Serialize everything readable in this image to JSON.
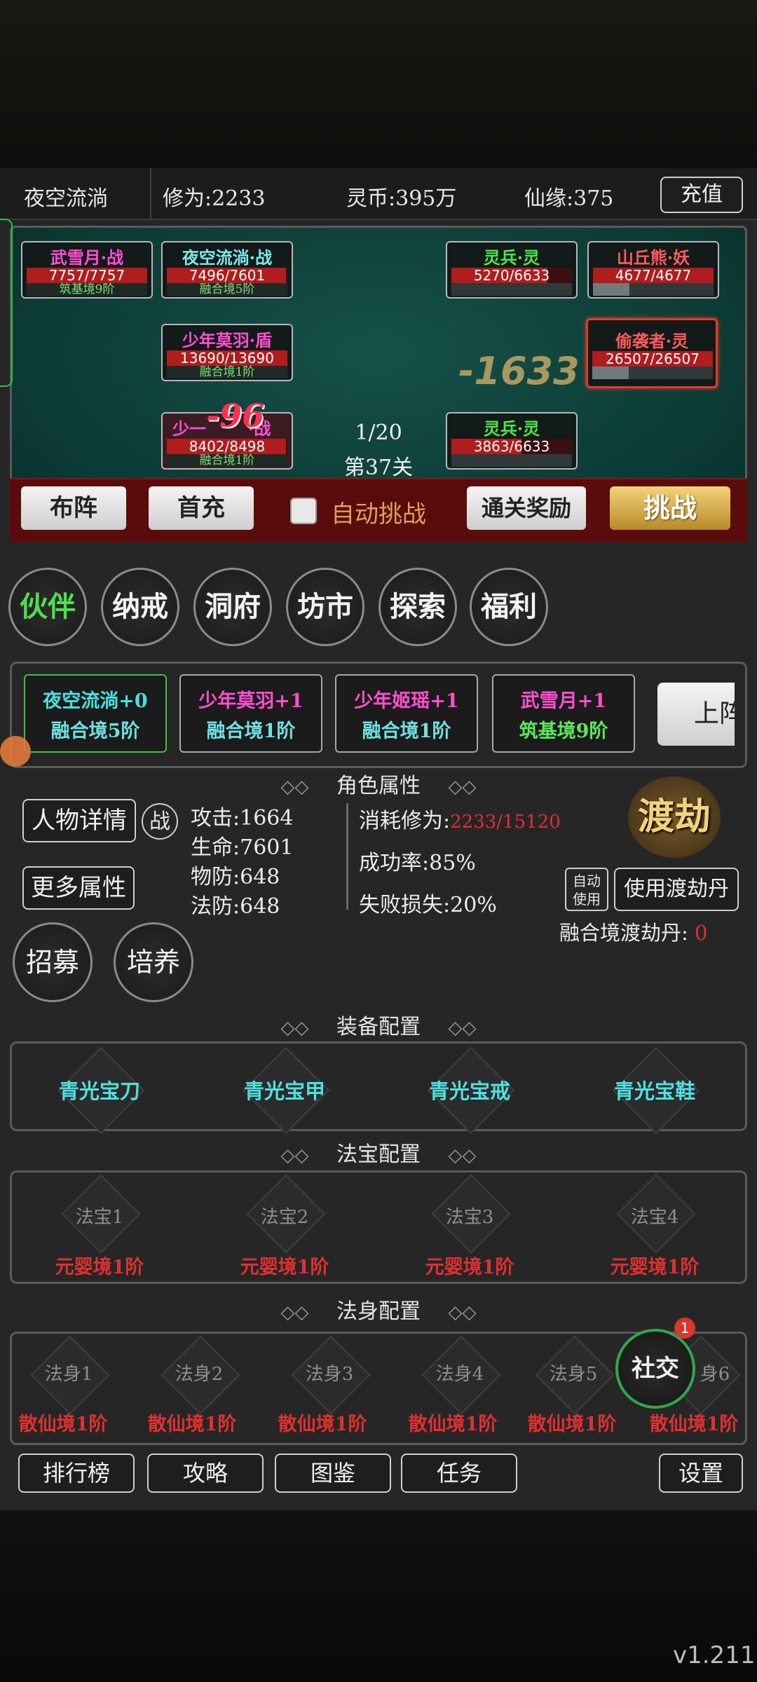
{
  "topbar": {
    "player": "夜空流淌",
    "cultivation": "修为:2233",
    "coins": "灵币:395万",
    "fate": "仙缘:375",
    "recharge": "充值"
  },
  "battle": {
    "allies": [
      {
        "name": "武雪月·战",
        "hp": "7757/7757",
        "realm": "筑基境9阶",
        "hp_frac": 1.0,
        "color": "#ff4fd0"
      },
      {
        "name": "夜空流淌·战",
        "hp": "7496/7601",
        "realm": "融合境5阶",
        "hp_frac": 0.986,
        "color": "#7de8e8"
      },
      {
        "name": "少年莫羽·盾",
        "hp": "13690/13690",
        "realm": "融合境1阶",
        "hp_frac": 1.0,
        "color": "#ff4fd0"
      },
      {
        "name": "少一",
        "hp": "8402/8498",
        "realm": "融合境1阶",
        "hp_frac": 0.989,
        "color": "#ff4fd0",
        "suffix": "·战",
        "damage": "-96"
      }
    ],
    "enemies": [
      {
        "name": "灵兵·灵",
        "hp": "5270/6633",
        "hp_frac": 0.795,
        "color": "#4be84b",
        "mp_frac": 0.0
      },
      {
        "name": "山丘熊·妖",
        "hp": "4677/4677",
        "hp_frac": 1.0,
        "color": "#ff5a5a",
        "mp_frac": 0.3
      },
      {
        "name": "偷袭者·灵",
        "hp": "26507/26507",
        "hp_frac": 1.0,
        "color": "#ff5a5a",
        "mp_frac": 0.3
      },
      {
        "name": "灵兵·灵",
        "hp": "3863/6633",
        "hp_frac": 0.58,
        "color": "#4be84b",
        "mp_frac": 0.0
      }
    ],
    "floating_damage": "-1633",
    "wave": "1/20",
    "stage": "第37关",
    "controls": {
      "formation": "布阵",
      "first_charge": "首充",
      "auto_label": "自动挑战",
      "clear_reward": "通关奖励",
      "challenge": "挑战"
    }
  },
  "nav": [
    "伙伴",
    "纳戒",
    "洞府",
    "坊市",
    "探索",
    "福利"
  ],
  "team": [
    {
      "name": "夜空流淌+0",
      "realm": "融合境5阶",
      "name_color": "#4be0e0",
      "realm_color": "#6fe0e0"
    },
    {
      "name": "少年莫羽+1",
      "realm": "融合境1阶",
      "name_color": "#ff4fd0",
      "realm_color": "#6fe0e0"
    },
    {
      "name": "少年姬瑶+1",
      "realm": "融合境1阶",
      "name_color": "#ff4fd0",
      "realm_color": "#6fe0e0"
    },
    {
      "name": "武雪月+1",
      "realm": "筑基境9阶",
      "name_color": "#ff4fd0",
      "realm_color": "#5be85b"
    }
  ],
  "team_more": "上阵",
  "attributes": {
    "header": "角色属性",
    "detail_btn": "人物详情",
    "battle_tag": "战",
    "more_btn": "更多属性",
    "attack": "攻击:1664",
    "life": "生命:7601",
    "pdef": "物防:648",
    "mdef": "法防:648",
    "cost_label": "消耗修为:",
    "cost_value": "2233/15120",
    "success": "成功率:85%",
    "fail": "失败损失:20%",
    "tribulation": "渡劫",
    "auto_use": "自动使用",
    "use_pill": "使用渡劫丹",
    "pill_label": "融合境渡劫丹:",
    "pill_count": "0",
    "recruit": "招募",
    "train": "培养"
  },
  "equipment": {
    "header": "装备配置",
    "items": [
      "青光宝刀",
      "青光宝甲",
      "青光宝戒",
      "青光宝鞋"
    ]
  },
  "treasures": {
    "header": "法宝配置",
    "items": [
      {
        "name": "法宝1",
        "realm": "元婴境1阶"
      },
      {
        "name": "法宝2",
        "realm": "元婴境1阶"
      },
      {
        "name": "法宝3",
        "realm": "元婴境1阶"
      },
      {
        "name": "法宝4",
        "realm": "元婴境1阶"
      }
    ]
  },
  "bodies": {
    "header": "法身配置",
    "items": [
      {
        "name": "法身1",
        "realm": "散仙境1阶"
      },
      {
        "name": "法身2",
        "realm": "散仙境1阶"
      },
      {
        "name": "法身3",
        "realm": "散仙境1阶"
      },
      {
        "name": "法身4",
        "realm": "散仙境1阶"
      },
      {
        "name": "法身5",
        "realm": "散仙境1阶"
      },
      {
        "name": "身6",
        "realm": "散仙境1阶"
      }
    ]
  },
  "social": {
    "label": "社交",
    "badge": "1"
  },
  "bottom": {
    "rank": "排行榜",
    "guide": "攻略",
    "atlas": "图鉴",
    "task": "任务",
    "settings": "设置"
  },
  "version": "v1.211"
}
